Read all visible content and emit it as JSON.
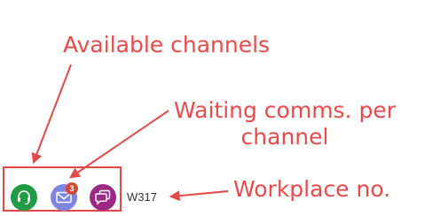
{
  "annotations": {
    "available_channels": "Available channels",
    "waiting_line1": "Waiting comms. per",
    "waiting_line2": "channel",
    "workplace_no": "Workplace no."
  },
  "channels": [
    {
      "id": "voice",
      "icon": "headset-icon",
      "color": "#1f9c45"
    },
    {
      "id": "email",
      "icon": "envelope-icon",
      "color": "#7f86e0",
      "waiting_count": "3"
    },
    {
      "id": "chat",
      "icon": "chat-bubble-icon",
      "color": "#9b2a86"
    }
  ],
  "workplace": {
    "number": "W317"
  },
  "colors": {
    "annotation": "#ea4a4a",
    "badge": "#d04a35"
  }
}
